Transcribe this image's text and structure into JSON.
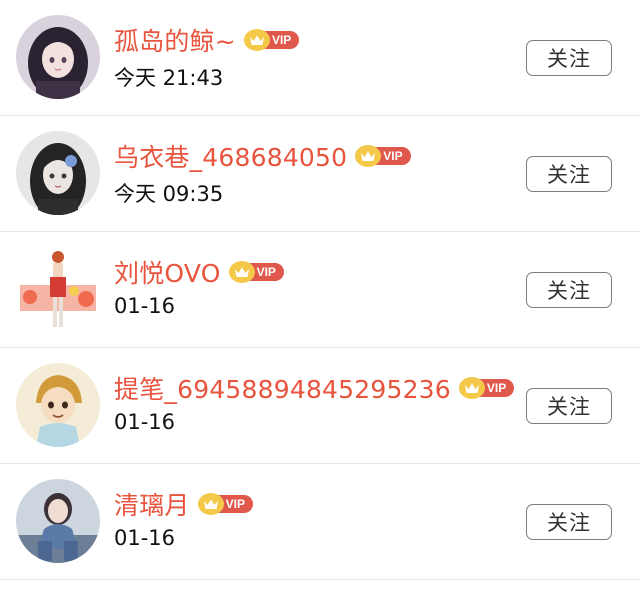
{
  "users": [
    {
      "name": "孤岛的鲸~",
      "time": "今天 21:43",
      "vip_label": "VIP",
      "follow_label": "关注"
    },
    {
      "name": "乌衣巷_468684050",
      "time": "今天 09:35",
      "vip_label": "VIP",
      "follow_label": "关注"
    },
    {
      "name": "刘悦OVO",
      "time": "01-16",
      "vip_label": "VIP",
      "follow_label": "关注"
    },
    {
      "name": "提笔_69458894845295236",
      "time": "01-16",
      "vip_label": "VIP",
      "follow_label": "关注"
    },
    {
      "name": "清璃月",
      "time": "01-16",
      "vip_label": "VIP",
      "follow_label": "关注"
    }
  ],
  "colors": {
    "name": "#e8543e",
    "vip_badge": "#e0584c",
    "crown": "#f4c94a"
  }
}
